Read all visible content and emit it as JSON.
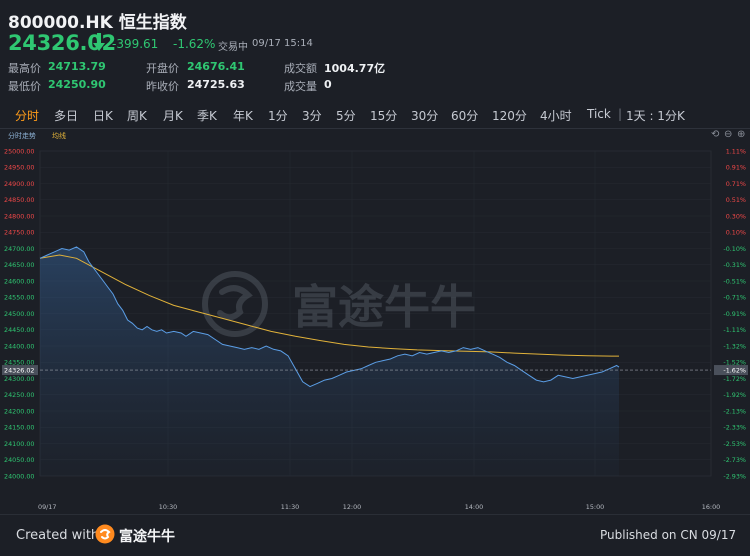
{
  "header": {
    "title": "800000.HK 恒生指数",
    "price": "24326.02",
    "change": "-399.61",
    "change_pct": "-1.62%",
    "status": "交易中",
    "time": "09/17 15:14"
  },
  "stats": [
    {
      "label": "最高价",
      "value": "24713.79"
    },
    {
      "label": "开盘价",
      "value": "24676.41"
    },
    {
      "label": "成交额",
      "value": "1004.77亿"
    },
    {
      "label": "最低价",
      "value": "24250.90"
    },
    {
      "label": "昨收价",
      "value": "24725.63"
    },
    {
      "label": "成交量",
      "value": "0"
    }
  ],
  "tabs": [
    "分时",
    "多日",
    "日K",
    "周K",
    "月K",
    "季K",
    "年K",
    "1分",
    "3分",
    "5分",
    "15分",
    "30分",
    "60分",
    "120分",
    "4小时",
    "Tick",
    "1天 : 1分K"
  ],
  "active_tab": "分时",
  "chart_legend": {
    "line1": "分时走势",
    "line2": "均线"
  },
  "footer": {
    "created_with": "Created with",
    "brand": "富途牛牛",
    "published": "Published on CN 09/17"
  },
  "colors": {
    "up": "#f04848",
    "down": "#2fc772",
    "price_line": "#5b9ee6",
    "avg_line": "#e1b23a",
    "accent": "#ff9c1a"
  },
  "chart_data": {
    "type": "line",
    "title": "",
    "xlabel": "",
    "ylabel": "",
    "x_ticks": [
      "09/17",
      "10:30",
      "11:30",
      "12:00",
      "14:00",
      "15:00",
      "16:00"
    ],
    "y_ticks": [
      25000,
      24950,
      24900,
      24850,
      24800,
      24750,
      24700,
      24650,
      24600,
      24550,
      24500,
      24450,
      24400,
      24350,
      24300,
      24250,
      24200,
      24150,
      24100,
      24050,
      24000
    ],
    "y_pct_ticks": [
      "1.11%",
      "0.91%",
      "0.71%",
      "0.51%",
      "0.30%",
      "0.10%",
      "-0.10%",
      "-0.31%",
      "-0.51%",
      "-0.71%",
      "-0.91%",
      "-1.11%",
      "-1.32%",
      "-1.52%",
      "-1.72%",
      "-1.92%",
      "-2.13%",
      "-2.33%",
      "-2.53%",
      "-2.73%",
      "-2.93%"
    ],
    "ylim": [
      24000,
      25000
    ],
    "current_price_label": "24326.02",
    "current_pct_label": "-1.62%",
    "reference_close": 24725.63,
    "series": [
      {
        "values": [
          [
            0,
            24670
          ],
          [
            3,
            24680
          ],
          [
            6,
            24690
          ],
          [
            9,
            24700
          ],
          [
            12,
            24695
          ],
          [
            15,
            24705
          ],
          [
            18,
            24690
          ],
          [
            20,
            24660
          ],
          [
            22,
            24640
          ],
          [
            24,
            24620
          ],
          [
            26,
            24600
          ],
          [
            28,
            24580
          ],
          [
            30,
            24560
          ],
          [
            32,
            24530
          ],
          [
            34,
            24510
          ],
          [
            36,
            24480
          ],
          [
            38,
            24470
          ],
          [
            40,
            24455
          ],
          [
            42,
            24450
          ],
          [
            44,
            24460
          ],
          [
            46,
            24450
          ],
          [
            48,
            24445
          ],
          [
            50,
            24450
          ],
          [
            52,
            24440
          ],
          [
            55,
            24445
          ],
          [
            58,
            24440
          ],
          [
            60,
            24430
          ],
          [
            63,
            24445
          ],
          [
            66,
            24440
          ],
          [
            69,
            24435
          ],
          [
            72,
            24420
          ],
          [
            75,
            24405
          ],
          [
            78,
            24400
          ],
          [
            81,
            24395
          ],
          [
            84,
            24390
          ],
          [
            87,
            24395
          ],
          [
            90,
            24390
          ],
          [
            93,
            24400
          ],
          [
            96,
            24390
          ],
          [
            99,
            24385
          ],
          [
            102,
            24370
          ],
          [
            105,
            24330
          ],
          [
            108,
            24290
          ],
          [
            111,
            24275
          ],
          [
            114,
            24285
          ],
          [
            117,
            24295
          ],
          [
            120,
            24300
          ],
          [
            123,
            24310
          ],
          [
            126,
            24320
          ],
          [
            129,
            24325
          ],
          [
            132,
            24330
          ],
          [
            135,
            24340
          ],
          [
            138,
            24350
          ],
          [
            141,
            24355
          ],
          [
            144,
            24360
          ],
          [
            147,
            24370
          ],
          [
            150,
            24375
          ],
          [
            153,
            24370
          ],
          [
            156,
            24380
          ],
          [
            159,
            24375
          ],
          [
            162,
            24380
          ],
          [
            165,
            24385
          ],
          [
            168,
            24380
          ],
          [
            171,
            24385
          ],
          [
            174,
            24395
          ],
          [
            177,
            24390
          ],
          [
            180,
            24395
          ],
          [
            183,
            24385
          ],
          [
            186,
            24375
          ],
          [
            189,
            24365
          ],
          [
            192,
            24350
          ],
          [
            195,
            24340
          ],
          [
            198,
            24325
          ],
          [
            201,
            24310
          ],
          [
            204,
            24295
          ],
          [
            207,
            24290
          ],
          [
            210,
            24295
          ],
          [
            213,
            24310
          ],
          [
            216,
            24305
          ],
          [
            219,
            24300
          ],
          [
            222,
            24305
          ],
          [
            225,
            24310
          ],
          [
            228,
            24315
          ],
          [
            231,
            24320
          ],
          [
            234,
            24330
          ],
          [
            237,
            24340
          ],
          [
            238,
            24335
          ]
        ]
      },
      {
        "values": [
          [
            0,
            24670
          ],
          [
            8,
            24680
          ],
          [
            15,
            24670
          ],
          [
            25,
            24630
          ],
          [
            35,
            24590
          ],
          [
            45,
            24555
          ],
          [
            55,
            24525
          ],
          [
            65,
            24505
          ],
          [
            75,
            24485
          ],
          [
            85,
            24465
          ],
          [
            95,
            24445
          ],
          [
            105,
            24430
          ],
          [
            115,
            24417
          ],
          [
            125,
            24405
          ],
          [
            135,
            24397
          ],
          [
            145,
            24392
          ],
          [
            155,
            24388
          ],
          [
            165,
            24386
          ],
          [
            175,
            24384
          ],
          [
            185,
            24382
          ],
          [
            195,
            24378
          ],
          [
            205,
            24375
          ],
          [
            215,
            24372
          ],
          [
            225,
            24370
          ],
          [
            235,
            24369
          ],
          [
            238,
            24369
          ]
        ]
      }
    ]
  }
}
